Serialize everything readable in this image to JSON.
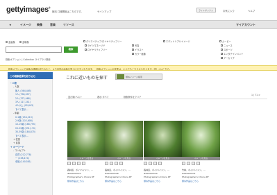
{
  "header": {
    "logo_text": "gettyimages",
    "logo_mark": "®",
    "signin_text": "無料 口座開設はこちらです。",
    "signup_text": "サインアップ",
    "button1": "ライトボックス",
    "link2": "お気に入り",
    "link3": "ヘルプ"
  },
  "nav": {
    "home_icon": "home-icon",
    "items": [
      "イメージ",
      "映像",
      "音楽",
      "リソース"
    ],
    "account": "マイアカウント"
  },
  "search": {
    "radio_1": "全画像",
    "radio_2": "全映像",
    "placeholder": "",
    "button_label": "検索",
    "extra_options": "検索オプション | Collection ライブラリ検索",
    "group1": [
      "クリエイティブ:ロイヤリティフリー",
      "ライツマネージド",
      "ロイヤリティフリー"
    ],
    "group2": [
      "写真",
      "イラスト",
      "カラー画像"
    ],
    "group3": [
      "エディトリアルイメージ"
    ],
    "group4_title": "ムービー",
    "group4": [
      "ニュース",
      "スポーツ",
      "エンタテインメント",
      "アーカイブ"
    ]
  },
  "notice": {
    "text": "検索オプションで画像の種類を絞り込むと、より目的の画像を見つけやすくなります。　検索オプションの変更は、いつでもこちらから行えます。詳しくはこちら。"
  },
  "sidebar": {
    "header": "この検索結果を絞り込む",
    "items": [
      {
        "text": "- 人物",
        "type": "h"
      },
      {
        "text": "- 人数",
        "type": "n"
      },
      {
        "text": "無人 (364,465)",
        "type": "a"
      },
      {
        "text": "1人 (798,097)",
        "type": "a"
      },
      {
        "text": "2人 (372,468)",
        "type": "a"
      },
      {
        "text": "3人 (117,241)",
        "type": "a"
      },
      {
        "text": "4人以上 (92,643)",
        "type": "a"
      },
      {
        "text": "すべて表示...",
        "type": "a"
      },
      {
        "text": "- 年齢",
        "type": "n"
      },
      {
        "text": "0-1歳 (154,213)",
        "type": "a"
      },
      {
        "text": "2-9歳 (102,608)",
        "type": "a"
      },
      {
        "text": "10-19歳 (166,795)",
        "type": "a"
      },
      {
        "text": "20-29歳 (331,170)",
        "type": "a"
      },
      {
        "text": "30-39歳 (184,875)",
        "type": "a"
      },
      {
        "text": "すべて表示...",
        "type": "a"
      },
      {
        "text": "+ 性別",
        "type": "n"
      },
      {
        "text": "+ 民族",
        "type": "n"
      },
      {
        "text": "+ キーワード",
        "type": "h"
      },
      {
        "text": "- コンセプト",
        "type": "n"
      },
      {
        "text": "自然 (212,778)",
        "type": "a"
      },
      {
        "text": "一 (158,474)",
        "type": "a"
      },
      {
        "text": "幸福 (140,581)",
        "type": "a"
      }
    ]
  },
  "main": {
    "title": "これに近いものを探す",
    "title_button": "類似イメージ検索",
    "toolbar": [
      "並び順:ベスト",
      "表示:すべて",
      "検索条件をクリア"
    ],
    "pager": "1 / 71 >",
    "thumb_bar_label": "イメージを見る",
    "captions": [
      {
        "title": "森林道、ボイ/ベイドン、...",
        "id": "#000000523",
        "source": "Photographer's Choice RF",
        "link": "類似作品はこちら"
      },
      {
        "title": "森林道、ボイ/ベイドン、...",
        "id": "#000000528",
        "source": "Photographer's Choice RF",
        "link": "類似作品はこちら"
      },
      {
        "title": "森林道、ボイ/ベイドン、...",
        "id": "#000000529",
        "source": "Photographer's Choice RF",
        "link": "類似作品はこちら"
      },
      {
        "title": "竹林、ボイ/ベイドン、...",
        "id": "#000000531",
        "source": "Photographer's Choice RF",
        "link": "類似作品はこちら"
      }
    ]
  },
  "colors": {
    "accent": "#3d9a2d",
    "link": "#2f6db5",
    "notice_bg": "#fff2b3"
  }
}
